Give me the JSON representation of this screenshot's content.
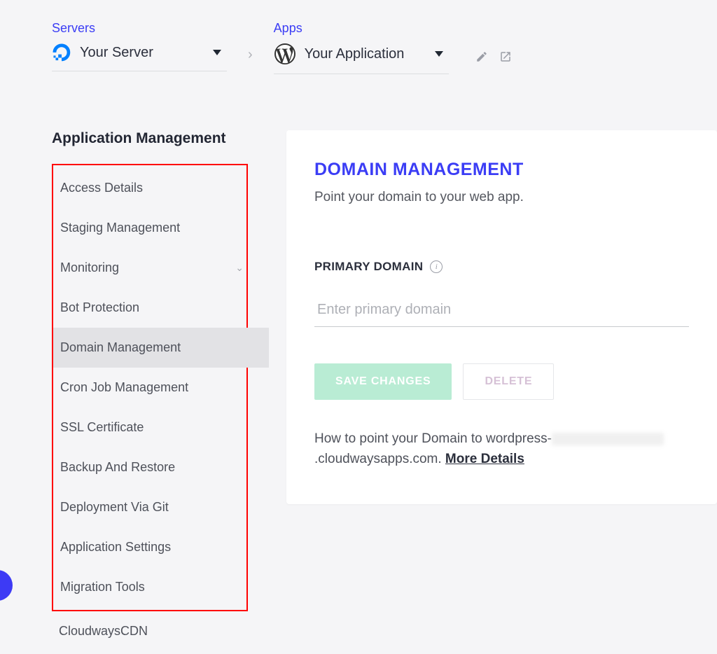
{
  "breadcrumb": {
    "servers_label": "Servers",
    "server_name": "Your Server",
    "apps_label": "Apps",
    "app_name": "Your Application"
  },
  "sidebar": {
    "title": "Application Management",
    "items": [
      {
        "label": "Access Details",
        "active": false,
        "expandable": false,
        "inRedBox": true
      },
      {
        "label": "Staging Management",
        "active": false,
        "expandable": false,
        "inRedBox": true
      },
      {
        "label": "Monitoring",
        "active": false,
        "expandable": true,
        "inRedBox": true
      },
      {
        "label": "Bot Protection",
        "active": false,
        "expandable": false,
        "inRedBox": true
      },
      {
        "label": "Domain Management",
        "active": true,
        "expandable": false,
        "inRedBox": true
      },
      {
        "label": "Cron Job Management",
        "active": false,
        "expandable": false,
        "inRedBox": true
      },
      {
        "label": "SSL Certificate",
        "active": false,
        "expandable": false,
        "inRedBox": true
      },
      {
        "label": "Backup And Restore",
        "active": false,
        "expandable": false,
        "inRedBox": true
      },
      {
        "label": "Deployment Via Git",
        "active": false,
        "expandable": false,
        "inRedBox": true
      },
      {
        "label": "Application Settings",
        "active": false,
        "expandable": false,
        "inRedBox": true
      },
      {
        "label": "Migration Tools",
        "active": false,
        "expandable": false,
        "inRedBox": true
      },
      {
        "label": "CloudwaysCDN",
        "active": false,
        "expandable": false,
        "inRedBox": false
      }
    ]
  },
  "content": {
    "title": "DOMAIN MANAGEMENT",
    "subtitle": "Point your domain to your web app.",
    "primary_domain_label": "PRIMARY DOMAIN",
    "primary_domain_placeholder": "Enter primary domain",
    "save_label": "SAVE CHANGES",
    "delete_label": "DELETE",
    "help_prefix": "How to point your Domain to wordpress-",
    "help_suffix": ".cloudwaysapps.com.  ",
    "more_label": "More Details"
  }
}
